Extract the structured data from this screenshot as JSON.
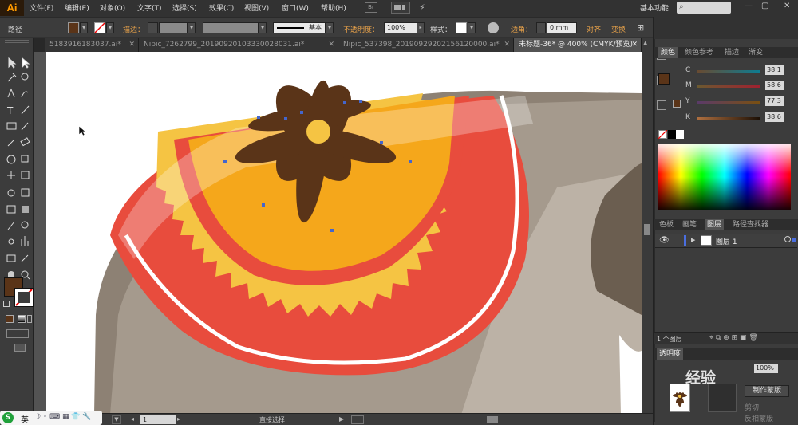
{
  "app": {
    "logo": "Ai",
    "workspace": "基本功能",
    "search_placeholder": ""
  },
  "menu": [
    "文件(F)",
    "编辑(E)",
    "对象(O)",
    "文字(T)",
    "选择(S)",
    "效果(C)",
    "视图(V)",
    "窗口(W)",
    "帮助(H)"
  ],
  "menu_extras": {
    "bridge": "Br"
  },
  "window_controls": {
    "min": "—",
    "max": "▢",
    "close": "✕"
  },
  "control_bar": {
    "path_label": "路径",
    "fill_color": "#5a3418",
    "stroke_label": "描边：",
    "stroke_style": "基本",
    "opacity_label": "不透明度：",
    "opacity_value": "100%",
    "style_label": "样式：",
    "corner_label": "边角：",
    "corner_value": "0 mm",
    "align_label": "对齐",
    "transform_label": "变换"
  },
  "tabs": [
    {
      "label": "5183916183037.ai*",
      "active": false
    },
    {
      "label": "Nipic_7262799_20190920103330028031.ai*",
      "active": false
    },
    {
      "label": "Nipic_537398_20190929202156120000.ai*",
      "active": false
    },
    {
      "label": "未标题-36* @ 400% (CMYK/预览)",
      "active": true
    }
  ],
  "tools": [
    "selection-tool",
    "direct-selection-tool",
    "magic-wand-tool",
    "lasso-tool",
    "pen-tool",
    "curvature-tool",
    "type-tool",
    "line-tool",
    "rectangle-tool",
    "paintbrush-tool",
    "pencil-tool",
    "eraser-tool",
    "rotate-tool",
    "scale-tool",
    "width-tool",
    "free-transform-tool",
    "shape-builder-tool",
    "perspective-tool",
    "mesh-tool",
    "gradient-tool",
    "eyedropper-tool",
    "blend-tool",
    "symbol-sprayer-tool",
    "column-graph-tool",
    "artboard-tool",
    "slice-tool",
    "hand-tool",
    "zoom-tool"
  ],
  "toolbox_colors": {
    "fill": "#5a3418",
    "stroke": "none"
  },
  "color_panel": {
    "tabs": [
      "颜色",
      "颜色参考",
      "描边",
      "渐变"
    ],
    "sliders": [
      {
        "label": "C",
        "value": "38.1",
        "color": "#00aeef"
      },
      {
        "label": "M",
        "value": "58.6",
        "color": "#ec008c"
      },
      {
        "label": "Y",
        "value": "77.3",
        "color": "#fff200"
      },
      {
        "label": "K",
        "value": "38.6",
        "color": "#000000"
      }
    ]
  },
  "layers_panel": {
    "tabs": [
      "色板",
      "画笔",
      "图层",
      "路径查找器"
    ],
    "layer_name": "图层 1",
    "layer_count": "1 个图层"
  },
  "transparency_panel": {
    "tab": "透明度",
    "opacity": "100%",
    "make_mask": "制作蒙版",
    "clip": "剪切",
    "invert": "反相蒙版"
  },
  "status_bar": {
    "zoom": "",
    "page": "1",
    "tool_status": "直接选择"
  },
  "ime": {
    "lang": "英"
  },
  "watermark": "经验"
}
